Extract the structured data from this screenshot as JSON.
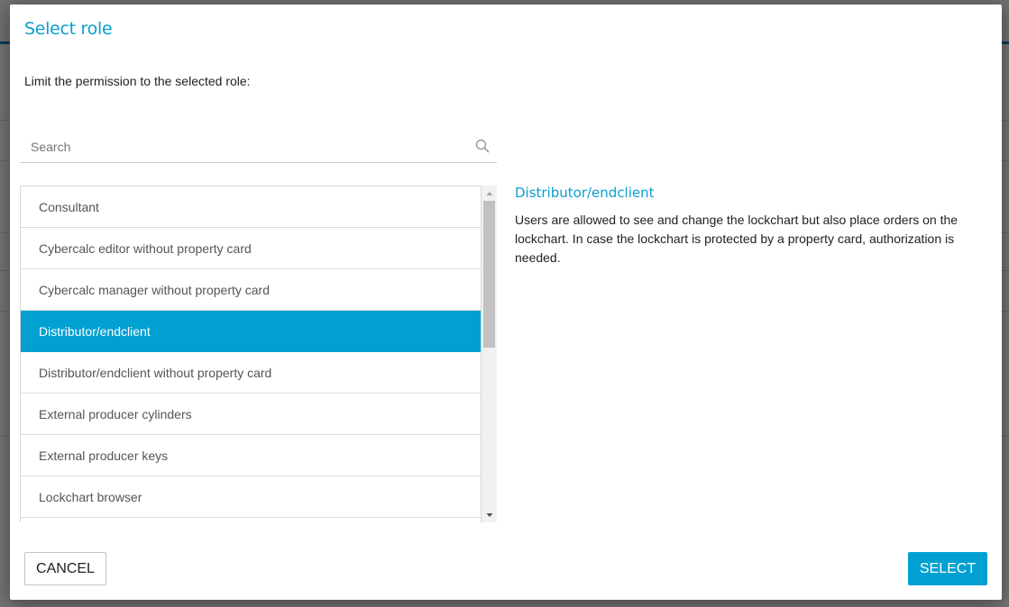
{
  "dialog": {
    "title": "Select role",
    "instruction": "Limit the permission to the selected role:"
  },
  "search": {
    "placeholder": "Search",
    "value": ""
  },
  "roles": [
    {
      "label": "Consultant",
      "selected": false
    },
    {
      "label": "Cybercalc editor without property card",
      "selected": false
    },
    {
      "label": "Cybercalc manager without property card",
      "selected": false
    },
    {
      "label": "Distributor/endclient",
      "selected": true
    },
    {
      "label": "Distributor/endclient without property card",
      "selected": false
    },
    {
      "label": "External producer cylinders",
      "selected": false
    },
    {
      "label": "External producer keys",
      "selected": false
    },
    {
      "label": "Lockchart browser",
      "selected": false
    }
  ],
  "detail": {
    "title": "Distributor/endclient",
    "description": "Users are allowed to see and change the lockchart but also place orders on the lockchart. In case the lockchart is protected by a property card, authorization is needed."
  },
  "buttons": {
    "cancel": "CANCEL",
    "select": "SELECT"
  },
  "colors": {
    "accent": "#00a0d2",
    "title": "#0b9fcf"
  },
  "icons": {
    "search": "search-icon",
    "scroll_up": "triangle-up-icon",
    "scroll_down": "triangle-down-icon"
  }
}
